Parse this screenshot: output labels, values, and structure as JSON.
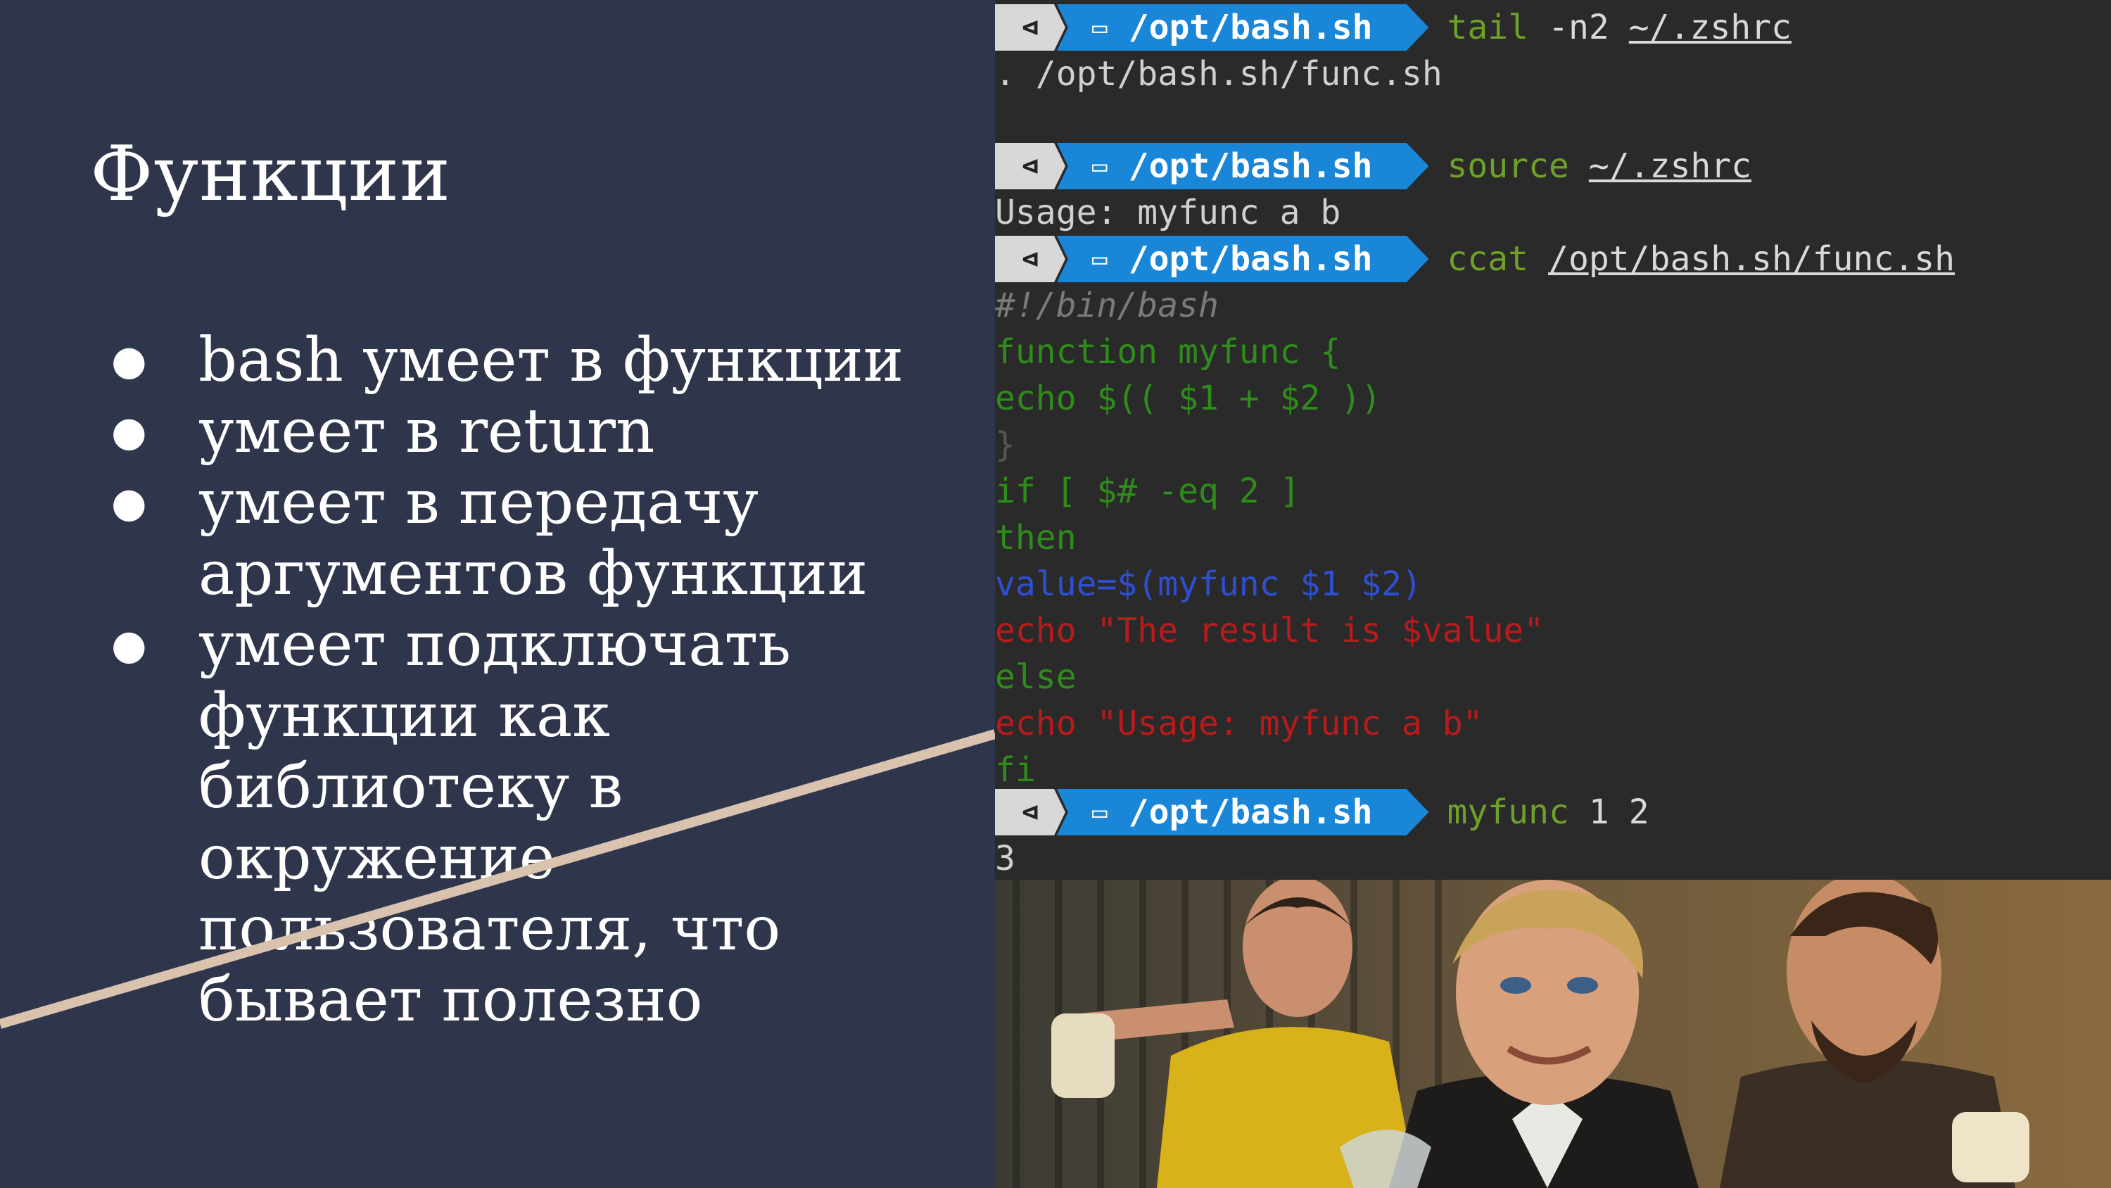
{
  "slide": {
    "title": "Функции",
    "bullets": [
      [
        "bash умеет в функции"
      ],
      [
        "умеет в return"
      ],
      [
        "умеет в передачу",
        "аргументов функции"
      ],
      [
        "умеет подключать",
        "функции как",
        "библиотеку в",
        "окружение",
        "пользователя, что",
        "бывает полезно"
      ]
    ]
  },
  "terminal": {
    "prompt": {
      "icon": "⊲",
      "folder_icon": "▭",
      "path": "/opt/bash.sh"
    },
    "blocks": [
      {
        "cmd": "tail",
        "args": [
          "-n2"
        ],
        "path": "~/.zshrc",
        "output": [
          ". /opt/bash.sh/func.sh",
          ""
        ]
      },
      {
        "cmd": "source",
        "args": [],
        "path": "~/.zshrc",
        "output": [
          "Usage: myfunc a b"
        ]
      },
      {
        "cmd": "ccat",
        "args": [],
        "path": "/opt/bash.sh/func.sh",
        "code": [
          "#!/bin/bash",
          "function myfunc {",
          "echo $(( $1 + $2 ))",
          "}",
          "if [ $# -eq 2 ]",
          "then",
          "value=$(myfunc $1 $2)",
          "echo \"The result is $value\"",
          "else",
          "echo \"Usage: myfunc a b\"",
          "fi"
        ]
      },
      {
        "cmd": "myfunc",
        "args": [
          "1",
          "2"
        ],
        "path": "",
        "output": [
          "3"
        ]
      }
    ]
  },
  "colors": {
    "background": "#2f364b",
    "accent_line": "#d9c3ae",
    "prompt_blue": "#1a86d8",
    "prompt_gray": "#d8d8d8",
    "cmd_green": "#6fa02a"
  }
}
